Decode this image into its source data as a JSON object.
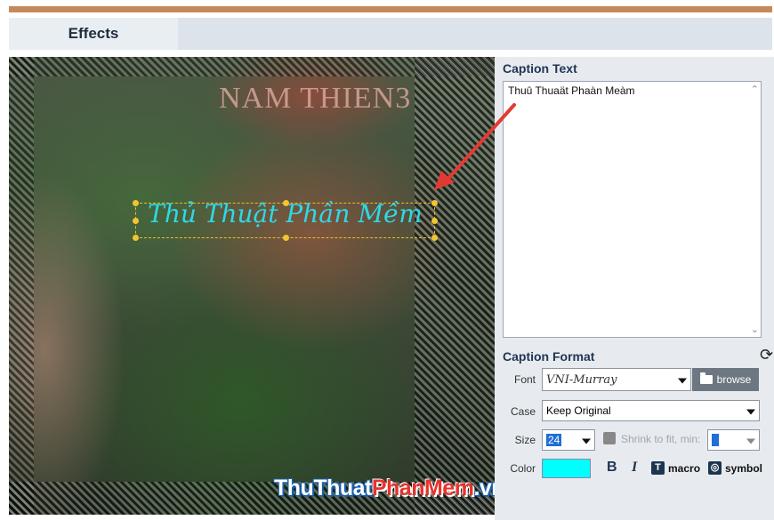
{
  "tabs": {
    "effects": "Effects"
  },
  "preview": {
    "sign_text": "NAM THIEN3",
    "caption_text": "Thủ Thuật Phần Mềm",
    "watermark_part1": "ThuThuat",
    "watermark_part2": "PhanMem",
    "watermark_part3": ".vn"
  },
  "caption_text_section": {
    "title": "Caption Text",
    "value": "Thuû Thuaät Phaàn Meàm"
  },
  "caption_format": {
    "title": "Caption Format",
    "font_label": "Font",
    "font_value": "VNI-Murray",
    "browse_label": "browse",
    "case_label": "Case",
    "case_value": "Keep Original",
    "size_label": "Size",
    "size_value": "24",
    "shrink_label": "Shrink to fit, min:",
    "color_label": "Color",
    "color_value": "#00ffff",
    "bold_label": "B",
    "italic_label": "I",
    "macro_icon_glyph": "T",
    "macro_label": "macro",
    "symbol_icon_glyph": "◎",
    "symbol_label": "symbol"
  },
  "colors": {
    "accent_top": "#c68a5a",
    "caption_cyan": "#2fd8e6",
    "annotation_arrow": "#e23a33"
  }
}
